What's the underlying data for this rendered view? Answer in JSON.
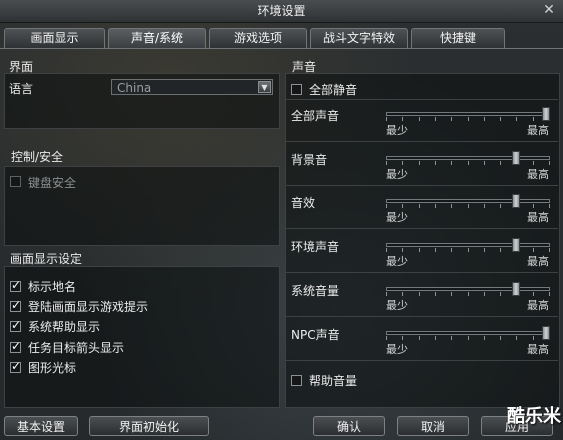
{
  "window": {
    "title": "环境设置"
  },
  "tabs": [
    {
      "label": "画面显示",
      "active": false
    },
    {
      "label": "声音/系统",
      "active": true
    },
    {
      "label": "游戏选项",
      "active": false
    },
    {
      "label": "战斗文字特效",
      "active": false
    },
    {
      "label": "快捷键",
      "active": false
    }
  ],
  "left": {
    "interface": {
      "title": "界面",
      "language_label": "语言",
      "language_value": "China"
    },
    "control": {
      "title": "控制/安全",
      "keyboard_security": {
        "label": "键盘安全",
        "checked": false
      }
    },
    "display": {
      "title": "画面显示设定",
      "options": [
        {
          "label": "标示地名",
          "checked": true
        },
        {
          "label": "登陆画面显示游戏提示",
          "checked": true
        },
        {
          "label": "系统帮助显示",
          "checked": true
        },
        {
          "label": "任务目标箭头显示",
          "checked": true
        },
        {
          "label": "图形光标",
          "checked": true
        }
      ]
    }
  },
  "right": {
    "title": "声音",
    "mute_all": {
      "label": "全部静音",
      "checked": false
    },
    "min_label": "最少",
    "max_label": "最高",
    "sliders": [
      {
        "label": "全部声音",
        "value": 1.0
      },
      {
        "label": "背景音",
        "value": 0.81
      },
      {
        "label": "音效",
        "value": 0.81
      },
      {
        "label": "环境声音",
        "value": 0.81
      },
      {
        "label": "系统音量",
        "value": 0.81
      },
      {
        "label": "NPC声音",
        "value": 1.0
      }
    ],
    "help_volume": {
      "label": "帮助音量",
      "checked": false
    }
  },
  "footer": {
    "basic_settings": "基本设置",
    "reset_display": "界面初始化",
    "confirm": "确认",
    "cancel": "取消",
    "apply": "应用"
  },
  "watermark": "酷乐米"
}
